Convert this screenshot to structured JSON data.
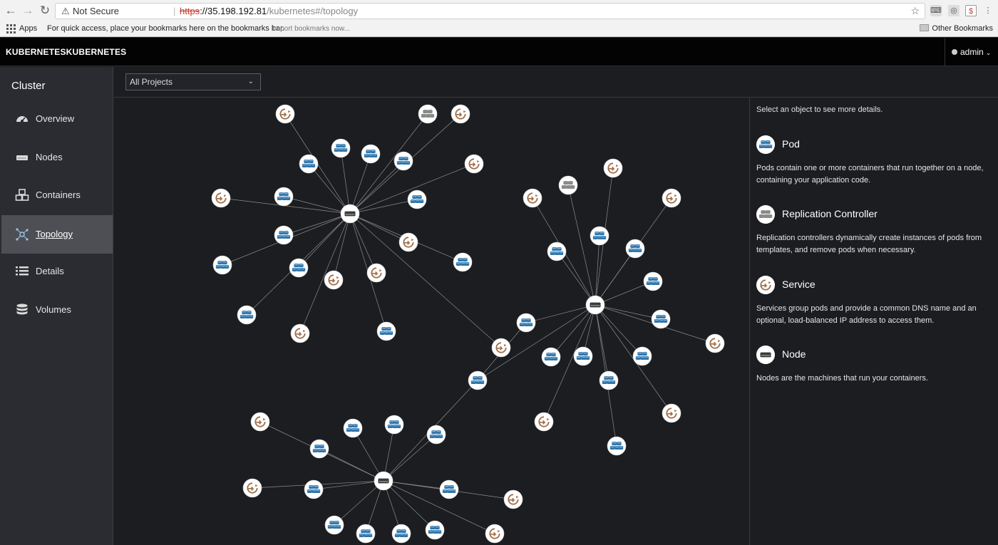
{
  "browser": {
    "back_icon": "arrow-left-icon",
    "forward_icon": "arrow-right-icon",
    "reload_icon": "reload-icon",
    "security_label": "Not Secure",
    "url_protocol": "https",
    "url_host": "://35.198.192.81",
    "url_path": "/kubernetes#/topology",
    "bookmarks_apps": "Apps",
    "bookmarks_hint": "For quick access, place your bookmarks here on the bookmarks bar.",
    "bookmarks_import": "Import bookmarks now...",
    "other_bookmarks": "Other Bookmarks"
  },
  "header": {
    "brand": "KUBERNETESKUBERNETES",
    "user": "admin"
  },
  "sidebar": {
    "title": "Cluster",
    "items": [
      {
        "label": "Overview",
        "icon": "dashboard-icon"
      },
      {
        "label": "Nodes",
        "icon": "server-icon"
      },
      {
        "label": "Containers",
        "icon": "cubes-icon"
      },
      {
        "label": "Topology",
        "icon": "topology-icon",
        "active": true
      },
      {
        "label": "Details",
        "icon": "list-icon"
      },
      {
        "label": "Volumes",
        "icon": "database-icon"
      }
    ]
  },
  "toolbar": {
    "project_filter": "All Projects"
  },
  "details": {
    "hint": "Select an object to see more details.",
    "legend": [
      {
        "title": "Pod",
        "icon": "pod-icon",
        "description": "Pods contain one or more containers that run together on a node, containing your application code."
      },
      {
        "title": "Replication Controller",
        "icon": "replication-controller-icon",
        "description": "Replication controllers dynamically create instances of pods from templates, and remove pods when necessary."
      },
      {
        "title": "Service",
        "icon": "service-icon",
        "description": "Services group pods and provide a common DNS name and an optional, load-balanced IP address to access them."
      },
      {
        "title": "Node",
        "icon": "node-icon",
        "description": "Nodes are the machines that run your containers."
      }
    ]
  },
  "colors": {
    "pod": "#2f74a9",
    "service": "#a0704a",
    "node": "#3a3a3a",
    "rc": "#8a8a8a",
    "edge": "#8c8c8c"
  },
  "topology_graph": {
    "groups": [
      {
        "hub": "node",
        "members": [
          "service",
          "rc",
          "service",
          "pod",
          "pod",
          "pod",
          "pod",
          "service",
          "service",
          "pod",
          "pod",
          "pod",
          "service",
          "pod",
          "pod",
          "pod",
          "service",
          "service",
          "pod",
          "service",
          "pod",
          "service"
        ]
      },
      {
        "hub": "node",
        "members": [
          "service",
          "rc",
          "service",
          "service",
          "pod",
          "pod",
          "pod",
          "pod",
          "pod",
          "service",
          "pod",
          "pod",
          "pod",
          "pod",
          "pod",
          "service",
          "service",
          "pod",
          "pod",
          "service"
        ]
      },
      {
        "hub": "node",
        "members": [
          "service",
          "pod",
          "pod",
          "pod",
          "pod",
          "service",
          "pod",
          "pod",
          "service",
          "pod",
          "pod",
          "pod",
          "pod",
          "service"
        ]
      }
    ]
  }
}
